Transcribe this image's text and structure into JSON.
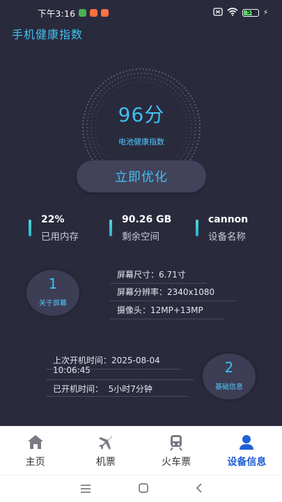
{
  "status_bar": {
    "time": "下午3:16",
    "battery": "55",
    "notification_colors": [
      "#4caf50",
      "#ff6e40",
      "#ff7043"
    ]
  },
  "app": {
    "title": "手机健康指数"
  },
  "health": {
    "score": "96分",
    "label": "电池健康指数",
    "optimize_button": "立即优化"
  },
  "stats": [
    {
      "value": "22%",
      "label": "已用内存"
    },
    {
      "value": "90.26 GB",
      "label": "剩余空间"
    },
    {
      "value": "cannon",
      "label": "设备名称"
    }
  ],
  "screen_section": {
    "number": "1",
    "title": "关于屏幕",
    "lines": [
      "屏幕尺寸：6.71寸",
      "屏幕分辨率：2340x1080",
      "摄像头：12MP+13MP"
    ]
  },
  "basic_section": {
    "number": "2",
    "title": "基础信息",
    "last_boot_label": "上次开机时间：2025-08-04",
    "last_boot_time": "10:06:45",
    "uptime": "已开机时间：  5小时7分钟"
  },
  "bottom_nav": {
    "items": [
      {
        "label": "主页",
        "icon": "home-icon"
      },
      {
        "label": "机票",
        "icon": "airplane-icon"
      },
      {
        "label": "火车票",
        "icon": "train-icon"
      },
      {
        "label": "设备信息",
        "icon": "user-icon"
      }
    ],
    "active_index": 3
  },
  "colors": {
    "background": "#2a2a3d",
    "accent": "#3ec1f2",
    "active_nav": "#1f5fd6"
  }
}
